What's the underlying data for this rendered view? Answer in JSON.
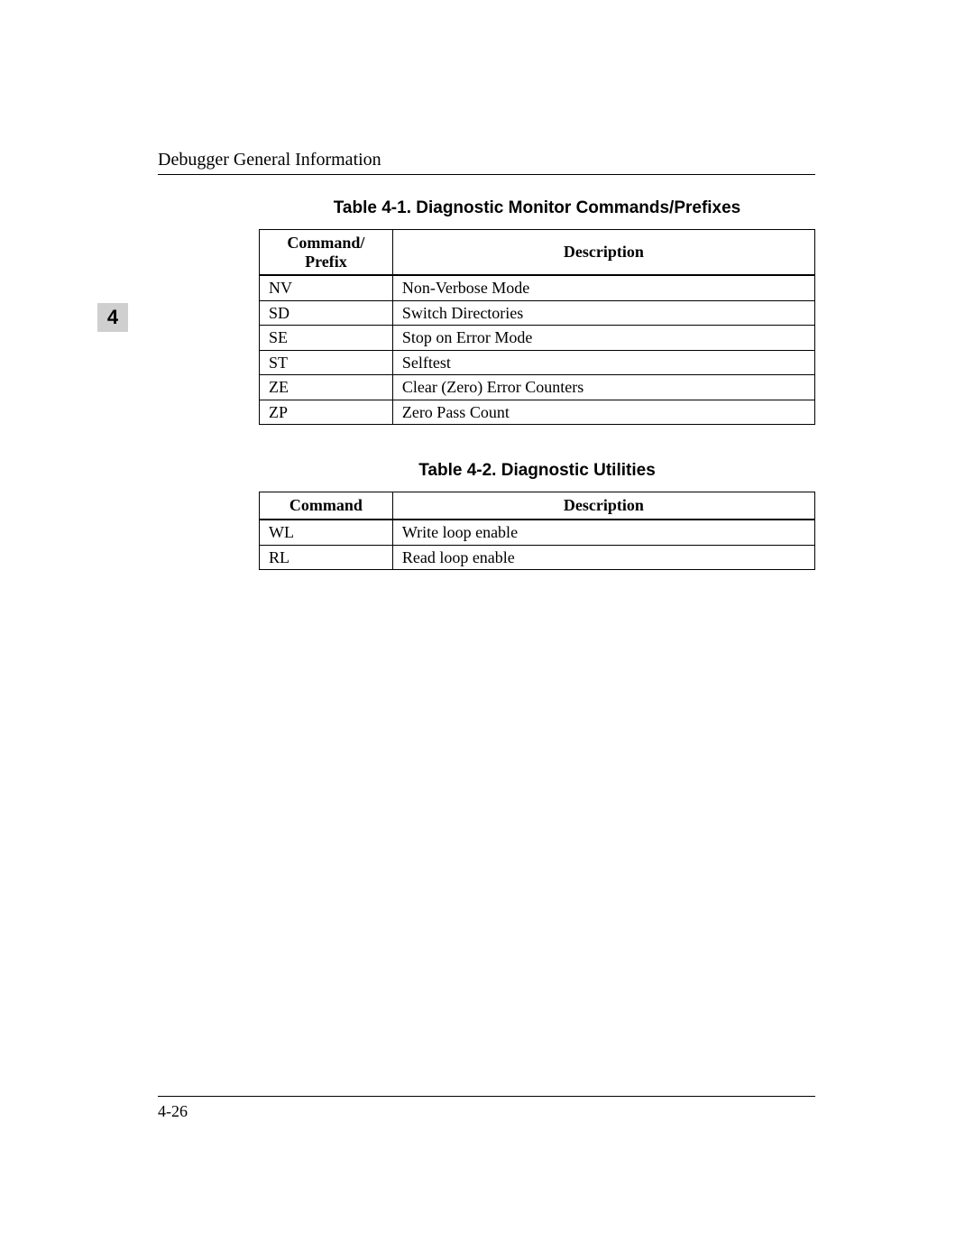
{
  "header": {
    "running_head": "Debugger General Information"
  },
  "chapter_tab": "4",
  "table1": {
    "caption": "Table 4-1.  Diagnostic Monitor Commands/Prefixes",
    "col1_header_line1": "Command/",
    "col1_header_line2": "Prefix",
    "col2_header": "Description",
    "rows": [
      {
        "cmd": "NV",
        "desc": "Non-Verbose Mode"
      },
      {
        "cmd": "SD",
        "desc": "Switch Directories"
      },
      {
        "cmd": "SE",
        "desc": "Stop on Error Mode"
      },
      {
        "cmd": "ST",
        "desc": "Selftest"
      },
      {
        "cmd": "ZE",
        "desc": "Clear (Zero) Error Counters"
      },
      {
        "cmd": "ZP",
        "desc": "Zero Pass Count"
      }
    ]
  },
  "table2": {
    "caption": "Table 4-2.  Diagnostic Utilities",
    "col1_header": "Command",
    "col2_header": "Description",
    "rows": [
      {
        "cmd": "WL",
        "desc": "Write loop enable"
      },
      {
        "cmd": "RL",
        "desc": "Read loop enable"
      }
    ]
  },
  "footer": {
    "page_number": "4-26"
  }
}
